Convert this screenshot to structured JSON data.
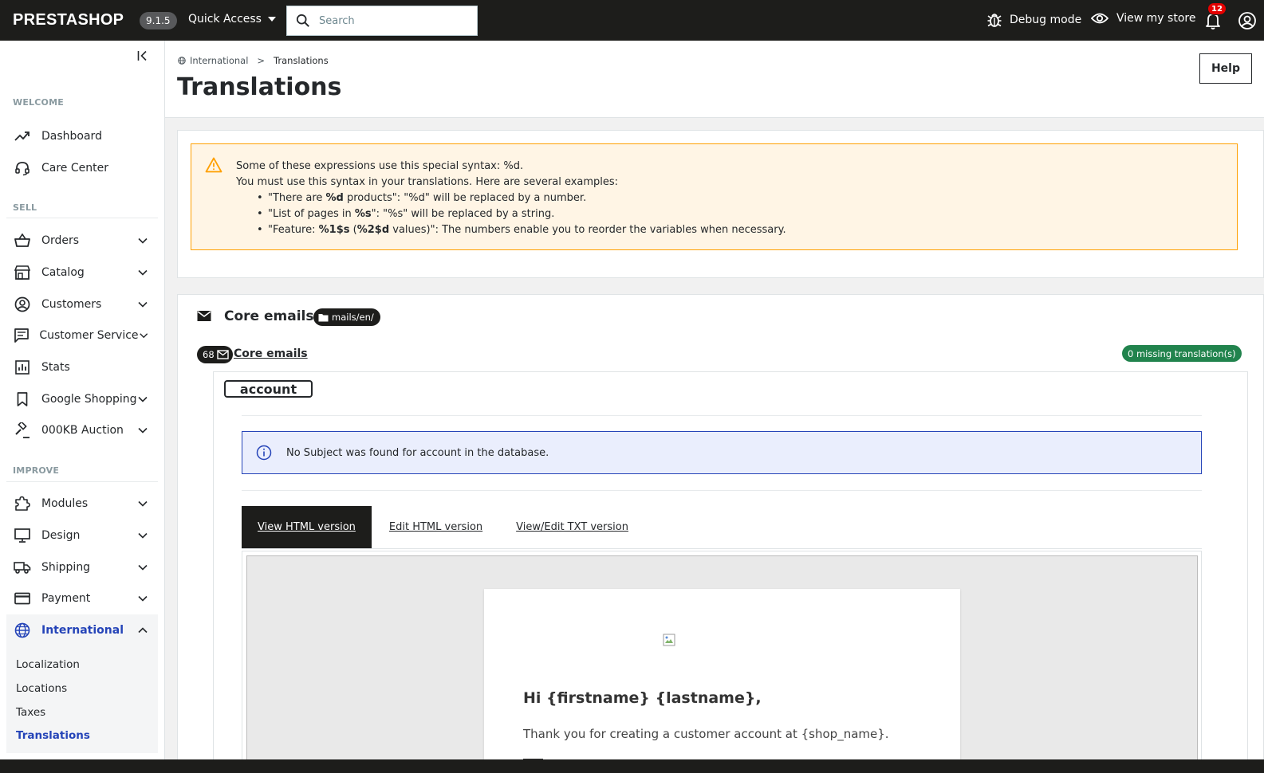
{
  "topbar": {
    "logo": "PRESTASHOP",
    "version": "9.1.5",
    "quick_access": "Quick Access",
    "search_placeholder": "Search",
    "debug_mode": "Debug mode",
    "view_store": "View my store",
    "notifications_count": "12"
  },
  "sidebar": {
    "sections": {
      "welcome": "WELCOME",
      "sell": "SELL",
      "improve": "IMPROVE"
    },
    "items": {
      "dashboard": "Dashboard",
      "care_center": "Care Center",
      "orders": "Orders",
      "catalog": "Catalog",
      "customers": "Customers",
      "customer_service": "Customer Service",
      "stats": "Stats",
      "google_shopping": "Google Shopping",
      "auction": "000KB Auction",
      "modules": "Modules",
      "design": "Design",
      "shipping": "Shipping",
      "payment": "Payment",
      "international": "International"
    },
    "international_sub": {
      "localization": "Localization",
      "locations": "Locations",
      "taxes": "Taxes",
      "translations": "Translations"
    }
  },
  "header": {
    "breadcrumb_parent": "International",
    "breadcrumb_sep": ">",
    "breadcrumb_current": "Translations",
    "title": "Translations",
    "help": "Help"
  },
  "warning": {
    "line1": "Some of these expressions use this special syntax: %d.",
    "line2": "You must use this syntax in your translations. Here are several examples:",
    "ex1_pre": "\"There are ",
    "ex1_bold": "%d",
    "ex1_post": " products\": \"%d\" will be replaced by a number.",
    "ex2_pre": "\"List of pages in ",
    "ex2_bold": "%s",
    "ex2_post": "\": \"%s\" will be replaced by a string.",
    "ex3_pre": "\"Feature: ",
    "ex3_bold1": "%1$s",
    "ex3_mid": " (",
    "ex3_bold2": "%2$d",
    "ex3_post": " values)\": The numbers enable you to reorder the variables when necessary."
  },
  "emails": {
    "title": "Core emails",
    "path_badge": "mails/en/",
    "count": "68",
    "link": "Core emails",
    "missing": "0 missing translation(s)",
    "template_name": "account",
    "info": "No Subject was found for account in the database.",
    "tabs": {
      "view_html": "View HTML version",
      "edit_html": "Edit HTML version",
      "view_txt": "View/Edit TXT version"
    },
    "preview": {
      "greeting": "Hi {firstname} {lastname},",
      "body": "Thank you for creating a customer account at {shop_name}."
    }
  },
  "colors": {
    "topbar": "#1d1d1b",
    "accent": "#2544b8",
    "warning_bg": "#fff5e5",
    "warning_border": "#ffa000",
    "success": "#21834d",
    "danger": "#e50000"
  }
}
